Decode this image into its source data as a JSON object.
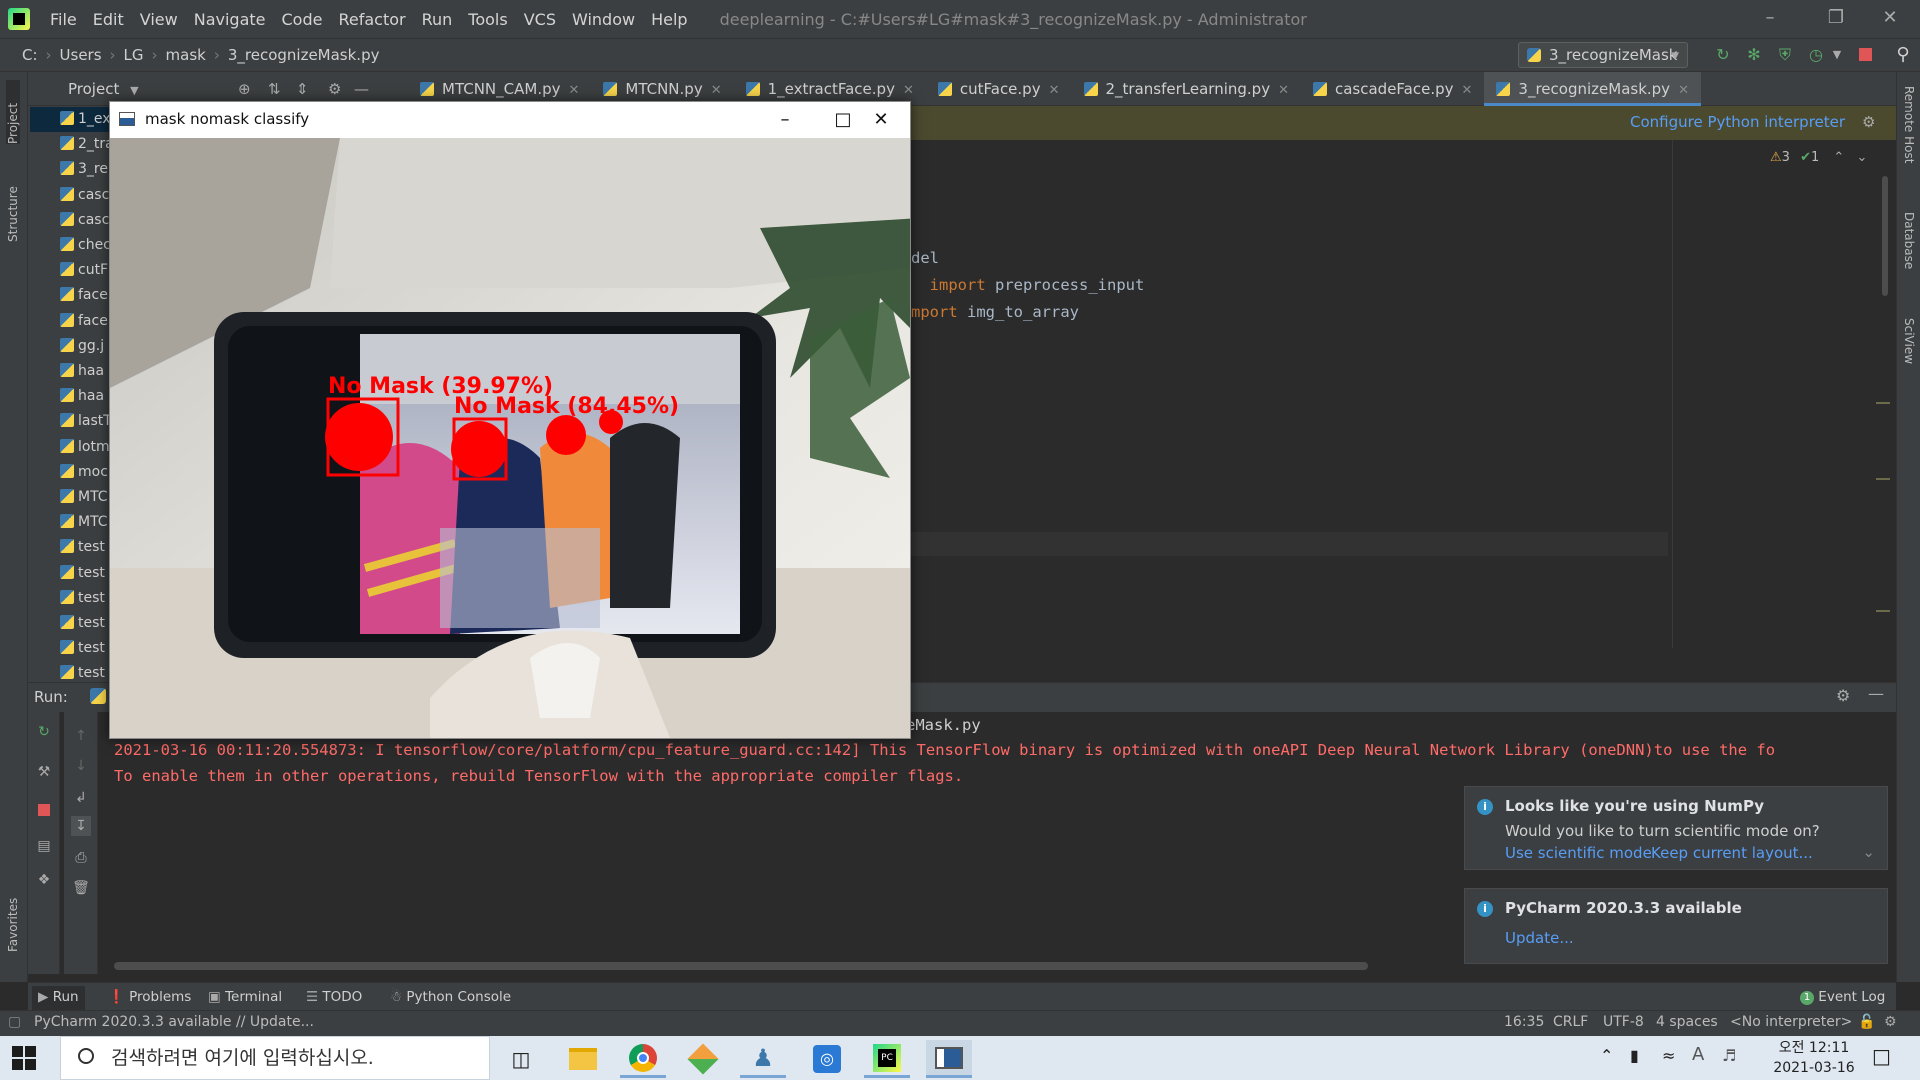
{
  "menubar": {
    "items": [
      "File",
      "Edit",
      "View",
      "Navigate",
      "Code",
      "Refactor",
      "Run",
      "Tools",
      "VCS",
      "Window",
      "Help"
    ],
    "window_title": "deeplearning - C:#Users#LG#mask#3_recognizeMask.py - Administrator"
  },
  "navbar": {
    "crumbs": [
      "C:",
      "Users",
      "LG",
      "mask",
      "3_recognizeMask.py"
    ],
    "run_config": "3_recognizeMask"
  },
  "project": {
    "header": "Project",
    "files": [
      "1_ex",
      "2_tra",
      "3_re",
      "casc",
      "casc",
      "chec",
      "cutF",
      "face",
      "face",
      "gg.j",
      "haa",
      "haa",
      "lastT",
      "lotm",
      "moc",
      "MTC",
      "MTC",
      "test",
      "test",
      "test",
      "test",
      "test",
      "test"
    ]
  },
  "tabs": [
    {
      "label": "MTCNN_CAM.py",
      "active": false
    },
    {
      "label": "MTCNN.py",
      "active": false
    },
    {
      "label": "1_extractFace.py",
      "active": false
    },
    {
      "label": "cutFace.py",
      "active": false
    },
    {
      "label": "2_transferLearning.py",
      "active": false
    },
    {
      "label": "cascadeFace.py",
      "active": false
    },
    {
      "label": "3_recognizeMask.py",
      "active": true
    }
  ],
  "editor": {
    "banner_link": "Configure Python interpreter",
    "warnings": "3",
    "weak_warnings": "1",
    "code_lines": [
      {
        "plain_before": "del",
        "kw": "",
        "plain_after": ""
      },
      {
        "plain_before": "",
        "kw": "import",
        "plain_after": " preprocess_input"
      },
      {
        "plain_before": "",
        "kw": "mport",
        "plain_after": " img_to_array"
      }
    ]
  },
  "run": {
    "label": "Run:",
    "script_line": "eMask.py",
    "log": [
      "2021-03-16 00:11:20.554873: I tensorflow/core/platform/cpu_feature_guard.cc:142] This TensorFlow binary is optimized with oneAPI Deep Neural Network Library (oneDNN)to use the fo",
      "To enable them in other operations, rebuild TensorFlow with the appropriate compiler flags."
    ]
  },
  "notifications": [
    {
      "title": "Looks like you're using NumPy",
      "body": "Would you like to turn scientific mode on?",
      "links": [
        "Use scientific mode",
        "Keep current layout..."
      ]
    },
    {
      "title": "PyCharm 2020.3.3 available",
      "body": "",
      "links": [
        "Update..."
      ]
    }
  ],
  "bottom_tabs": [
    "Run",
    "Problems",
    "Terminal",
    "TODO",
    "Python Console"
  ],
  "event_log": {
    "label": "Event Log",
    "count": "1"
  },
  "statusbar": {
    "message": "PyCharm 2020.3.3 available // Update...",
    "position": "16:35",
    "line_sep": "CRLF",
    "encoding": "UTF-8",
    "indent": "4 spaces",
    "interpreter": "<No interpreter>"
  },
  "side_labels": {
    "left": [
      "Project",
      "Structure",
      "Favorites"
    ],
    "right": [
      "Remote Host",
      "Database",
      "SciView"
    ]
  },
  "camera_window": {
    "title": "mask nomask classify",
    "labels": [
      "No Mask (39.97%)",
      "No Mask (84.45%)"
    ]
  },
  "taskbar": {
    "search_placeholder": "검색하려면 여기에 입력하십시오.",
    "time": "오전 12:11",
    "date": "2021-03-16"
  },
  "colors": {
    "ide_bg": "#2b2b2b",
    "panel_bg": "#3c3f41",
    "error_text": "#ff6b68",
    "link": "#589df6",
    "detection_red": "#ff0000"
  }
}
